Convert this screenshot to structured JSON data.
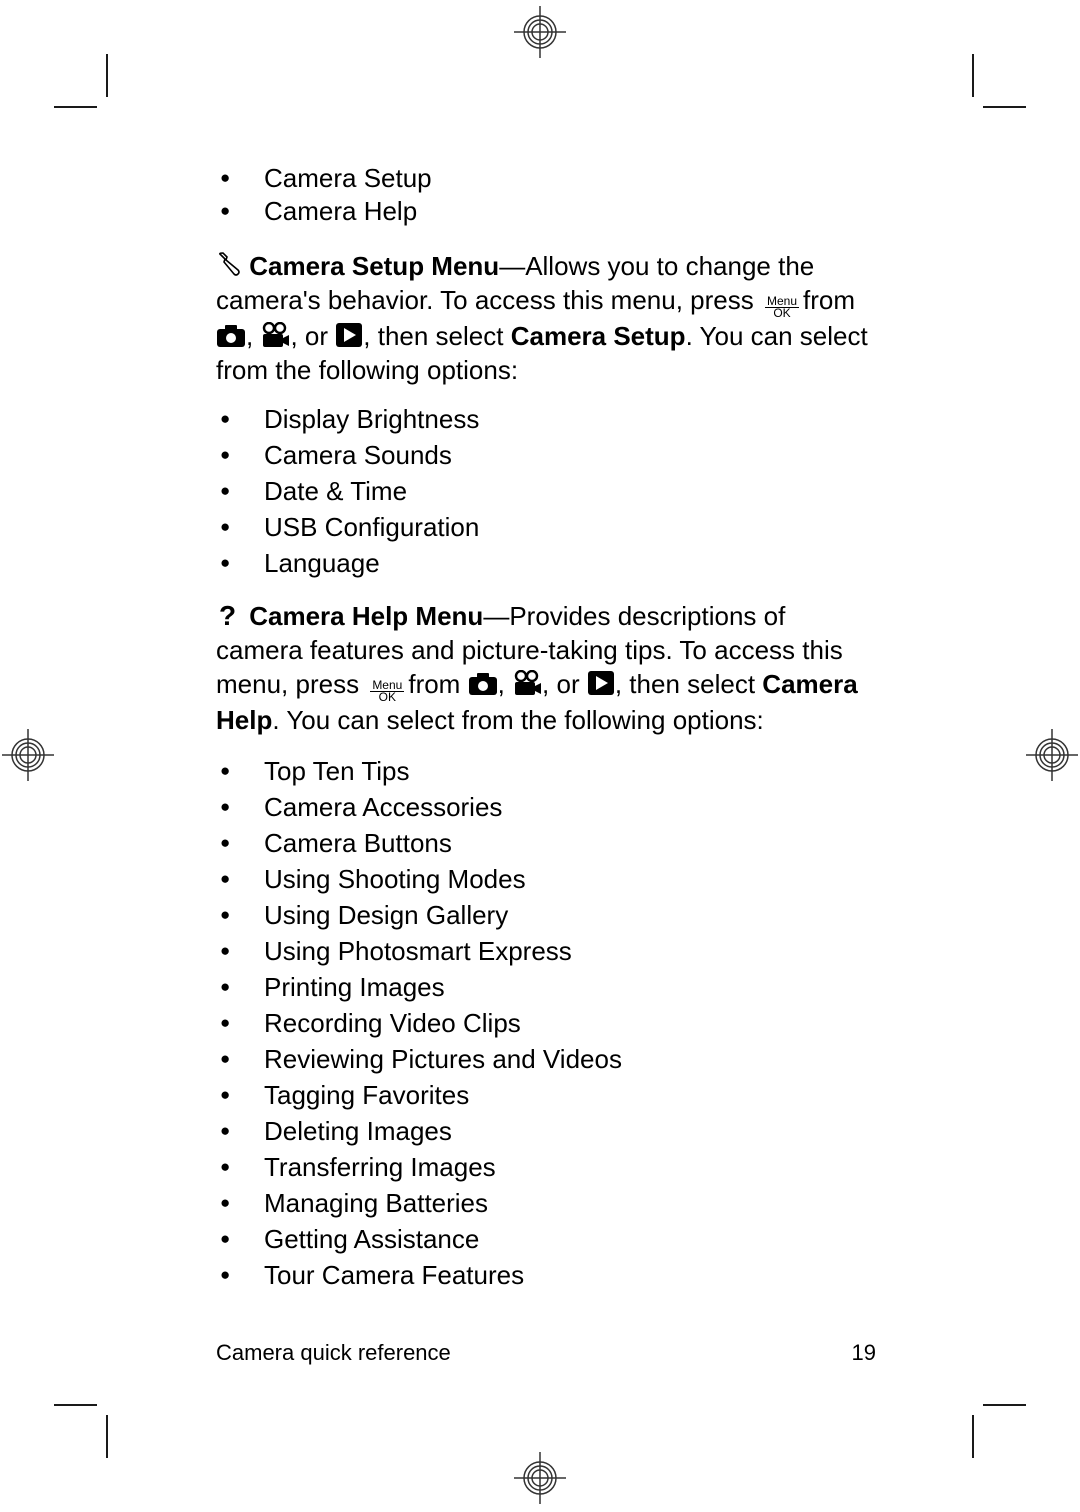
{
  "top_list": [
    "Camera Setup",
    "Camera Help"
  ],
  "setup": {
    "icon": "wrench-icon",
    "title": "Camera Setup Menu",
    "desc1": "—Allows you to change the camera's behavior. To access this menu, press",
    "button": {
      "top": "Menu",
      "bottom": "OK"
    },
    "from": "from",
    "sep1": ",",
    "sep2": ", or",
    "then": ", then select",
    "select_target": "Camera Setup",
    "tail": ". You can select from the following options:",
    "options": [
      "Display Brightness",
      "Camera Sounds",
      "Date & Time",
      "USB Configuration",
      "Language"
    ]
  },
  "help": {
    "icon": "question-icon",
    "title": "Camera Help Menu",
    "desc1": "—Provides descriptions of camera features and picture-taking tips. To access this menu, press",
    "button": {
      "top": "Menu",
      "bottom": "OK"
    },
    "from": "from",
    "sep1": ",",
    "sep2": ", or",
    "then": ", then select",
    "select_target": "Camera Help",
    "tail": ". You can select from the following options:",
    "options": [
      "Top Ten Tips",
      "Camera Accessories",
      "Camera Buttons",
      "Using Shooting Modes",
      "Using Design Gallery",
      "Using Photosmart Express",
      "Printing Images",
      "Recording Video Clips",
      "Reviewing Pictures and Videos",
      "Tagging Favorites",
      "Deleting Images",
      "Transferring Images",
      "Managing Batteries",
      "Getting Assistance",
      "Tour Camera Features"
    ]
  },
  "footer": {
    "section": "Camera quick reference",
    "page_number": "19"
  }
}
